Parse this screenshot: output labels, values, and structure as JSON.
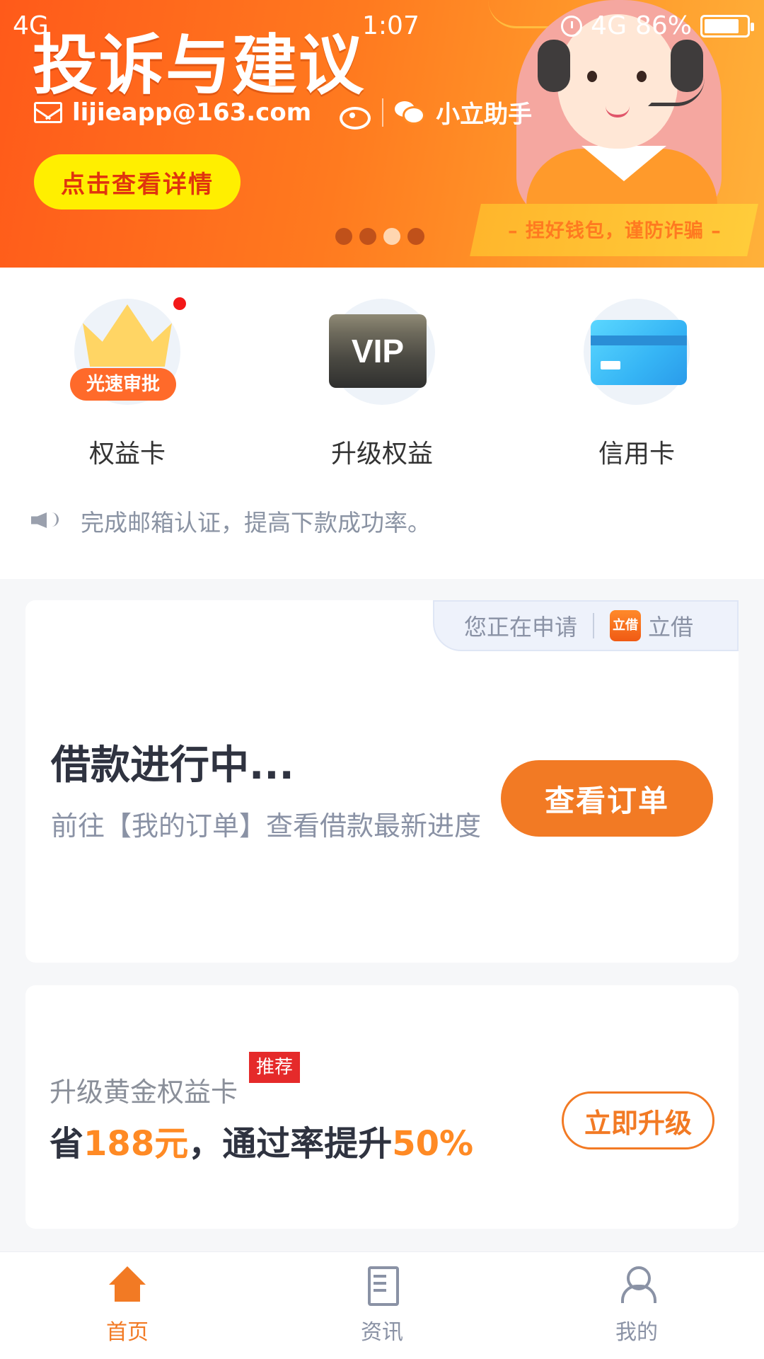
{
  "status_bar": {
    "left": "4G",
    "time": "1:07",
    "network": "4G",
    "battery": "86%"
  },
  "banner": {
    "title": "投诉与建议",
    "email": "lijieapp@163.com",
    "wechat_name": "小立助手",
    "detail_button": "点击查看详情",
    "slogan": "– 捏好钱包，谨防诈骗 –",
    "carousel": {
      "total": 4,
      "active_index": 2
    },
    "colors": {
      "primary": "#ff5a1a",
      "button": "#ffef00",
      "button_text": "#e0340e"
    }
  },
  "quick_entries": [
    {
      "label": "权益卡",
      "badge": "光速审批",
      "icon": "crown-icon",
      "has_red_dot": true
    },
    {
      "label": "升级权益",
      "card_text": "VIP",
      "icon": "vip-card-icon"
    },
    {
      "label": "信用卡",
      "icon": "credit-card-icon"
    }
  ],
  "notice": {
    "text": "完成邮箱认证，提高下款成功率。",
    "icon": "speaker-icon"
  },
  "loan_card": {
    "applying_label": "您正在申请",
    "product_logo_text": "立借",
    "product_name": "立借",
    "title": "借款进行中...",
    "subtitle": "前往【我的订单】查看借款最新进度",
    "button": "查看订单"
  },
  "upgrade_card": {
    "title": "升级黄金权益卡",
    "badge": "推荐",
    "line_prefix": "省",
    "amount": "188元",
    "line_middle": "，通过率提升",
    "rate": "50%",
    "button": "立即升级"
  },
  "tabbar": {
    "tabs": [
      {
        "label": "首页",
        "icon": "home-icon",
        "active": true
      },
      {
        "label": "资讯",
        "icon": "news-icon",
        "active": false
      },
      {
        "label": "我的",
        "icon": "profile-icon",
        "active": false
      }
    ],
    "accent": "#f27a24"
  }
}
